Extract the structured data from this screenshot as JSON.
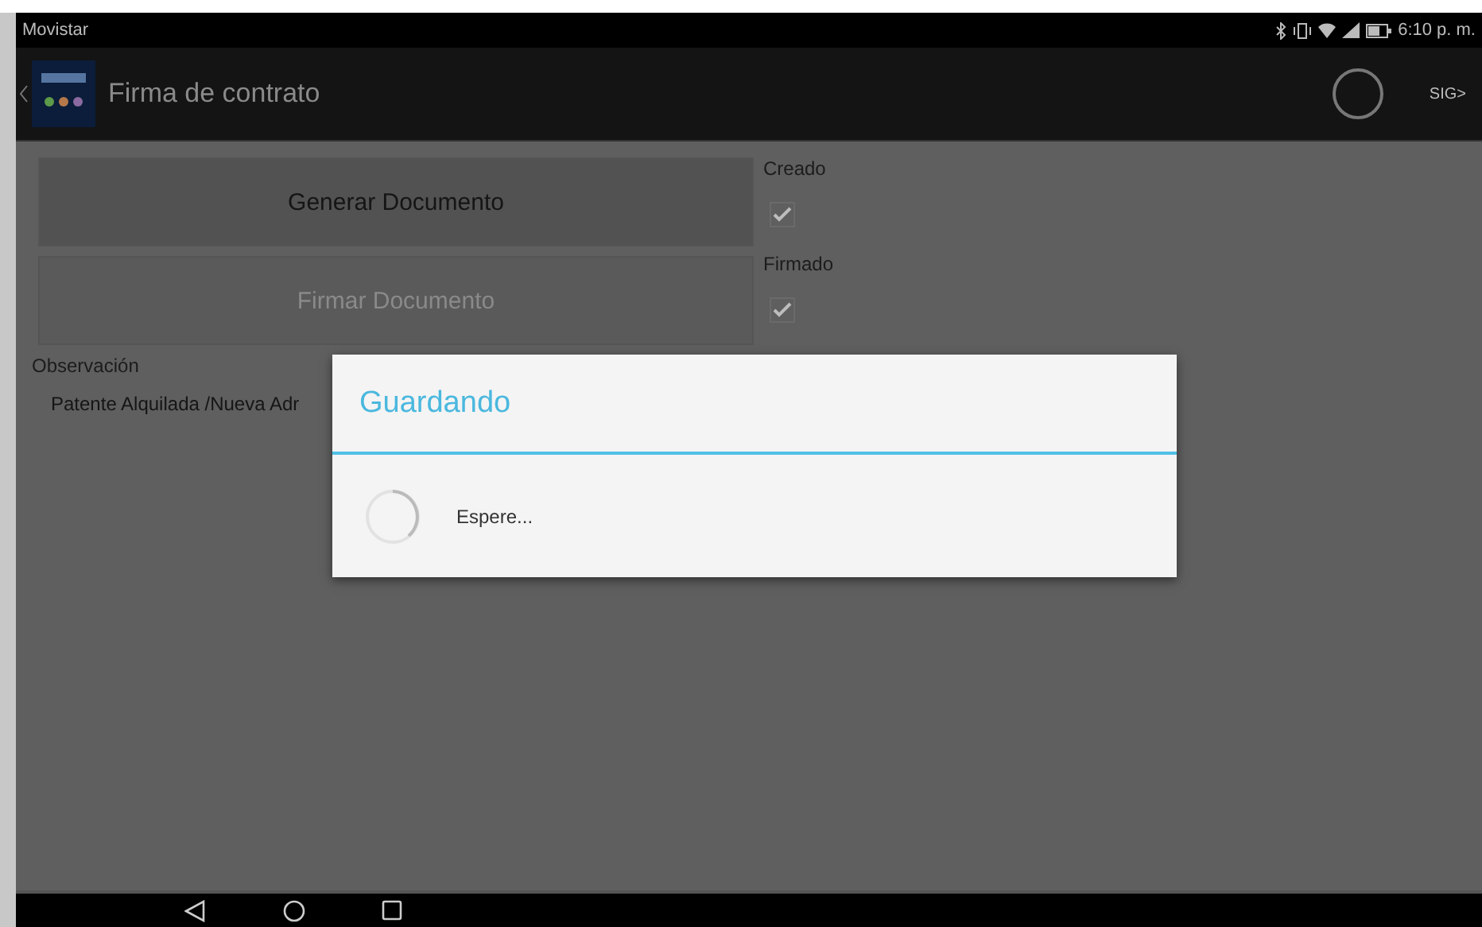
{
  "status_bar": {
    "carrier": "Movistar",
    "time": "6:10 p. m."
  },
  "action_bar": {
    "title": "Firma de contrato",
    "next_label": "SIG>"
  },
  "buttons": [
    {
      "label": "Generar Documento",
      "disabled": false
    },
    {
      "label": "Firmar Documento",
      "disabled": true
    }
  ],
  "checks": [
    {
      "label": "Creado",
      "checked": true
    },
    {
      "label": "Firmado",
      "checked": true
    }
  ],
  "observation": {
    "label": "Observación",
    "value": "Patente Alquilada /Nueva Adr"
  },
  "dialog": {
    "title": "Guardando",
    "message": "Espere..."
  }
}
